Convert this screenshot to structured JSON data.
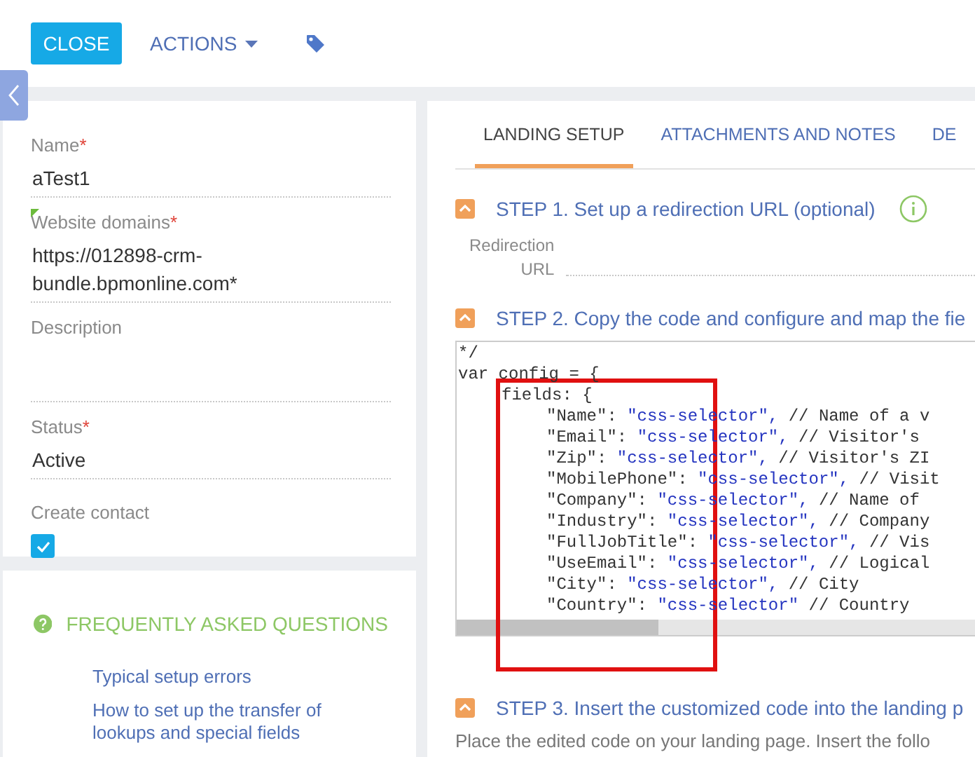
{
  "toolbar": {
    "close_button": "CLOSE",
    "actions_menu": "ACTIONS"
  },
  "fields": [
    {
      "label": "Name",
      "required": "*",
      "modified": false,
      "value": "aTest1"
    },
    {
      "label": "Website domains",
      "required": "*",
      "modified": true,
      "value": "https://012898-crm-bundle.bpmonline.com*"
    },
    {
      "label": "Description",
      "modified": false
    },
    {
      "label": "Status",
      "required": "*",
      "modified": false,
      "value": "Active"
    }
  ],
  "create_contact": {
    "label": "Create contact",
    "checked": true
  },
  "faq": {
    "title": "FREQUENTLY ASKED QUESTIONS",
    "links": [
      "Typical setup errors",
      "How to set up the transfer of lookups and special fields"
    ]
  },
  "tabs": [
    {
      "label": "LANDING SETUP",
      "selected": true
    },
    {
      "label": "ATTACHMENTS AND NOTES",
      "selected": false
    },
    {
      "label": "DE",
      "selected": false
    }
  ],
  "steps": [
    {
      "title": "STEP 1. Set up a redirection URL (optional)",
      "expanded": true,
      "info": true
    },
    {
      "title": "STEP 2. Copy the code and configure and map the fie",
      "expanded": true,
      "info": false
    },
    {
      "title": "STEP 3. Insert the customized code into the landing p",
      "expanded": true,
      "info": false
    }
  ],
  "redirection_url": {
    "label": "Redirection URL"
  },
  "code": {
    "preamble": [
      "*/",
      "var config = {"
    ],
    "block_open": "fields: {",
    "fields": [
      {
        "key": "\"Name\":",
        "value": "\"css-selector\",",
        "comment": "// Name of a v"
      },
      {
        "key": "\"Email\":",
        "value": "\"css-selector\",",
        "comment": "// Visitor's"
      },
      {
        "key": "\"Zip\":",
        "value": "\"css-selector\",",
        "comment": "// Visitor's ZI"
      },
      {
        "key": "\"MobilePhone\":",
        "value": "\"css-selector\",",
        "comment": "// Visit"
      },
      {
        "key": "\"Company\":",
        "value": "\"css-selector\",",
        "comment": "// Name of"
      },
      {
        "key": "\"Industry\":",
        "value": "\"css-selector\",",
        "comment": "// Company"
      },
      {
        "key": "\"FullJobTitle\":",
        "value": "\"css-selector\",",
        "comment": "// Vis"
      },
      {
        "key": "\"UseEmail\":",
        "value": "\"css-selector\",",
        "comment": "// Logical"
      },
      {
        "key": "\"City\":",
        "value": "\"css-selector\",",
        "comment": "// City"
      },
      {
        "key": "\"Country\":",
        "value": "\"css-selector\"",
        "comment": "// Country"
      }
    ]
  },
  "step3_text": "Place the edited code on your landing page. Insert the follo"
}
